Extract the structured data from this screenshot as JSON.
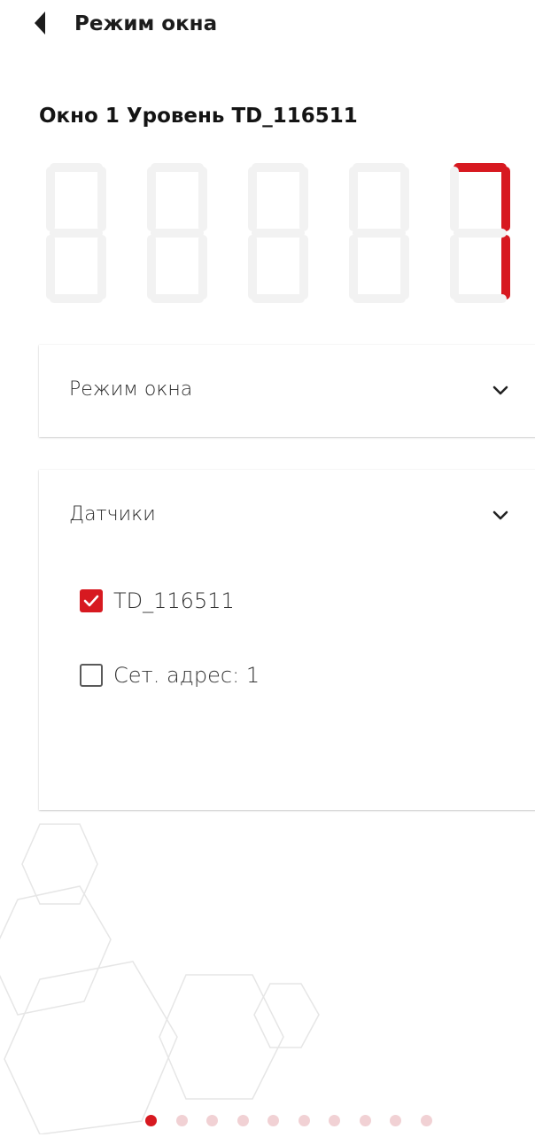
{
  "header": {
    "title": "Режим окна",
    "back_icon": "chevron-left-icon"
  },
  "page": {
    "title": "Окно 1 Уровень TD_116511"
  },
  "display": {
    "digits": [
      "",
      "",
      "",
      "",
      "7"
    ],
    "active_color": "#d71920",
    "inactive_color": "#f2f2f2"
  },
  "mode_section": {
    "label": "Режим окна",
    "icon": "chevron-down-icon"
  },
  "sensors_section": {
    "label": "Датчики",
    "icon": "chevron-down-icon",
    "items": [
      {
        "label": "TD_116511",
        "checked": true
      },
      {
        "label": "Сет. адрес: 1",
        "checked": false
      }
    ]
  },
  "pagination": {
    "total": 10,
    "active": 1
  },
  "colors": {
    "accent": "#d71920",
    "dot_inactive": "#f1d1d4"
  }
}
